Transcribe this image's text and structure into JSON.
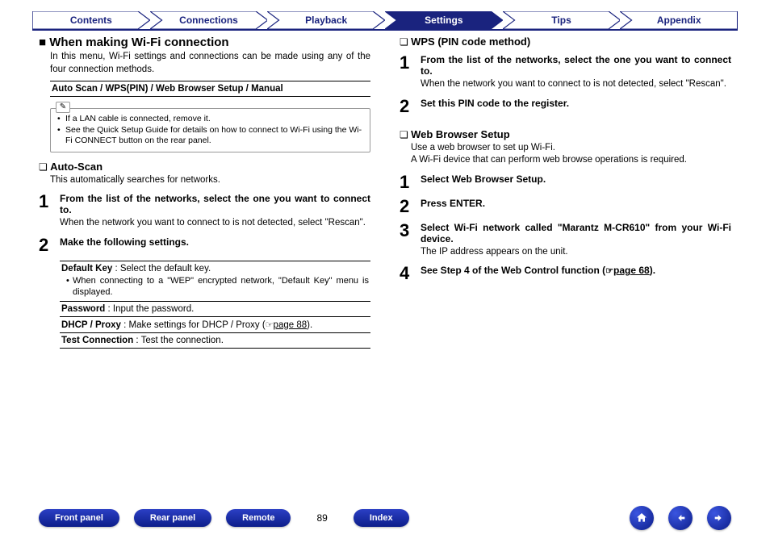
{
  "nav": {
    "tabs": [
      "Contents",
      "Connections",
      "Playback",
      "Settings",
      "Tips",
      "Appendix"
    ],
    "activeIndex": 3
  },
  "left": {
    "mainHeading": "When making Wi-Fi connection",
    "mainDesc": "In this menu, Wi-Fi settings and connections can be made using any of the four connection methods.",
    "methods": "Auto Scan / WPS(PIN) / Web Browser Setup / Manual",
    "notes": [
      "If a LAN cable is connected, remove it.",
      "See the Quick Setup Guide for details on how to connect to Wi-Fi using the Wi-Fi CONNECT button on the rear panel."
    ],
    "autoScan": {
      "heading": "Auto-Scan",
      "desc": "This automatically searches for networks.",
      "step1": {
        "num": "1",
        "title": "From the list of the networks, select the one you want to connect to.",
        "desc": "When the network you want to connect to is not detected, select \"Rescan\"."
      },
      "step2": {
        "num": "2",
        "title": "Make the following settings."
      },
      "settings": {
        "defaultKeyLabel": "Default Key",
        "defaultKeyText": " : Select the default key.",
        "defaultKeyNote": "When connecting to a \"WEP\" encrypted network, \"Default Key\" menu is displayed.",
        "passwordLabel": "Password",
        "passwordText": " : Input the password.",
        "dhcpLabel": "DHCP / Proxy",
        "dhcpText": " : Make settings for DHCP / Proxy (",
        "dhcpLink": "page 88",
        "dhcpTextEnd": ").",
        "testLabel": "Test Connection",
        "testText": " : Test the connection."
      }
    }
  },
  "right": {
    "wps": {
      "heading": "WPS (PIN code method)",
      "step1": {
        "num": "1",
        "title": "From the list of the networks, select the one you want to connect to.",
        "desc": "When the network you want to connect to is not detected, select \"Rescan\"."
      },
      "step2": {
        "num": "2",
        "title": "Set this PIN code to the register."
      }
    },
    "web": {
      "heading": "Web Browser Setup",
      "desc1": "Use a web browser to set up Wi-Fi.",
      "desc2": "A Wi-Fi device that can perform web browse operations is required.",
      "step1": {
        "num": "1",
        "title": "Select Web Browser Setup."
      },
      "step2": {
        "num": "2",
        "title": "Press ENTER."
      },
      "step3": {
        "num": "3",
        "title": "Select Wi-Fi network called \"Marantz M-CR610\" from your Wi-Fi device.",
        "desc": "The IP address appears on the unit."
      },
      "step4": {
        "num": "4",
        "titlePre": "See Step 4 of the Web Control function (",
        "link": "page 68",
        "titlePost": ")."
      }
    }
  },
  "bottom": {
    "frontPanel": "Front panel",
    "rearPanel": "Rear panel",
    "remote": "Remote",
    "pageNum": "89",
    "index": "Index"
  }
}
